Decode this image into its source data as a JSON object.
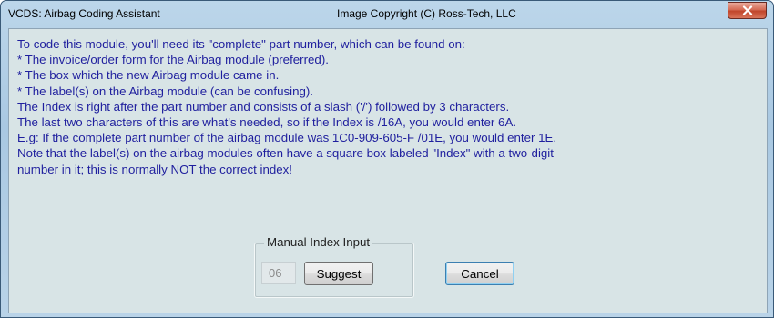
{
  "window": {
    "title": "VCDS:  Airbag Coding Assistant",
    "title_center": "Image Copyright (C) Ross-Tech, LLC"
  },
  "instructions": [
    "To code this module, you'll need its \"complete\" part number, which can be found on:",
    "* The invoice/order form for the Airbag module (preferred).",
    "* The box which the new Airbag module came in.",
    "* The label(s) on the Airbag module (can be confusing).",
    "The Index is right after the part number and consists of a slash ('/') followed by 3 characters.",
    "The last two characters of this are what's needed, so if the Index is /16A, you would enter 6A.",
    "E.g: If the complete part number of the airbag module was 1C0-909-605-F /01E, you would enter 1E.",
    "Note that the label(s) on the airbag modules often have a square box labeled \"Index\" with a two-digit",
    "number in it; this is normally NOT the correct index!"
  ],
  "manual_index": {
    "label": "Manual Index Input",
    "value": "06",
    "suggest_label": "Suggest"
  },
  "cancel_label": "Cancel",
  "icons": {
    "close": "close-icon"
  },
  "colors": {
    "instruction_text": "#1f1f9e",
    "close_button": "#c0452b",
    "dialog_background": "#d8e4e6"
  }
}
